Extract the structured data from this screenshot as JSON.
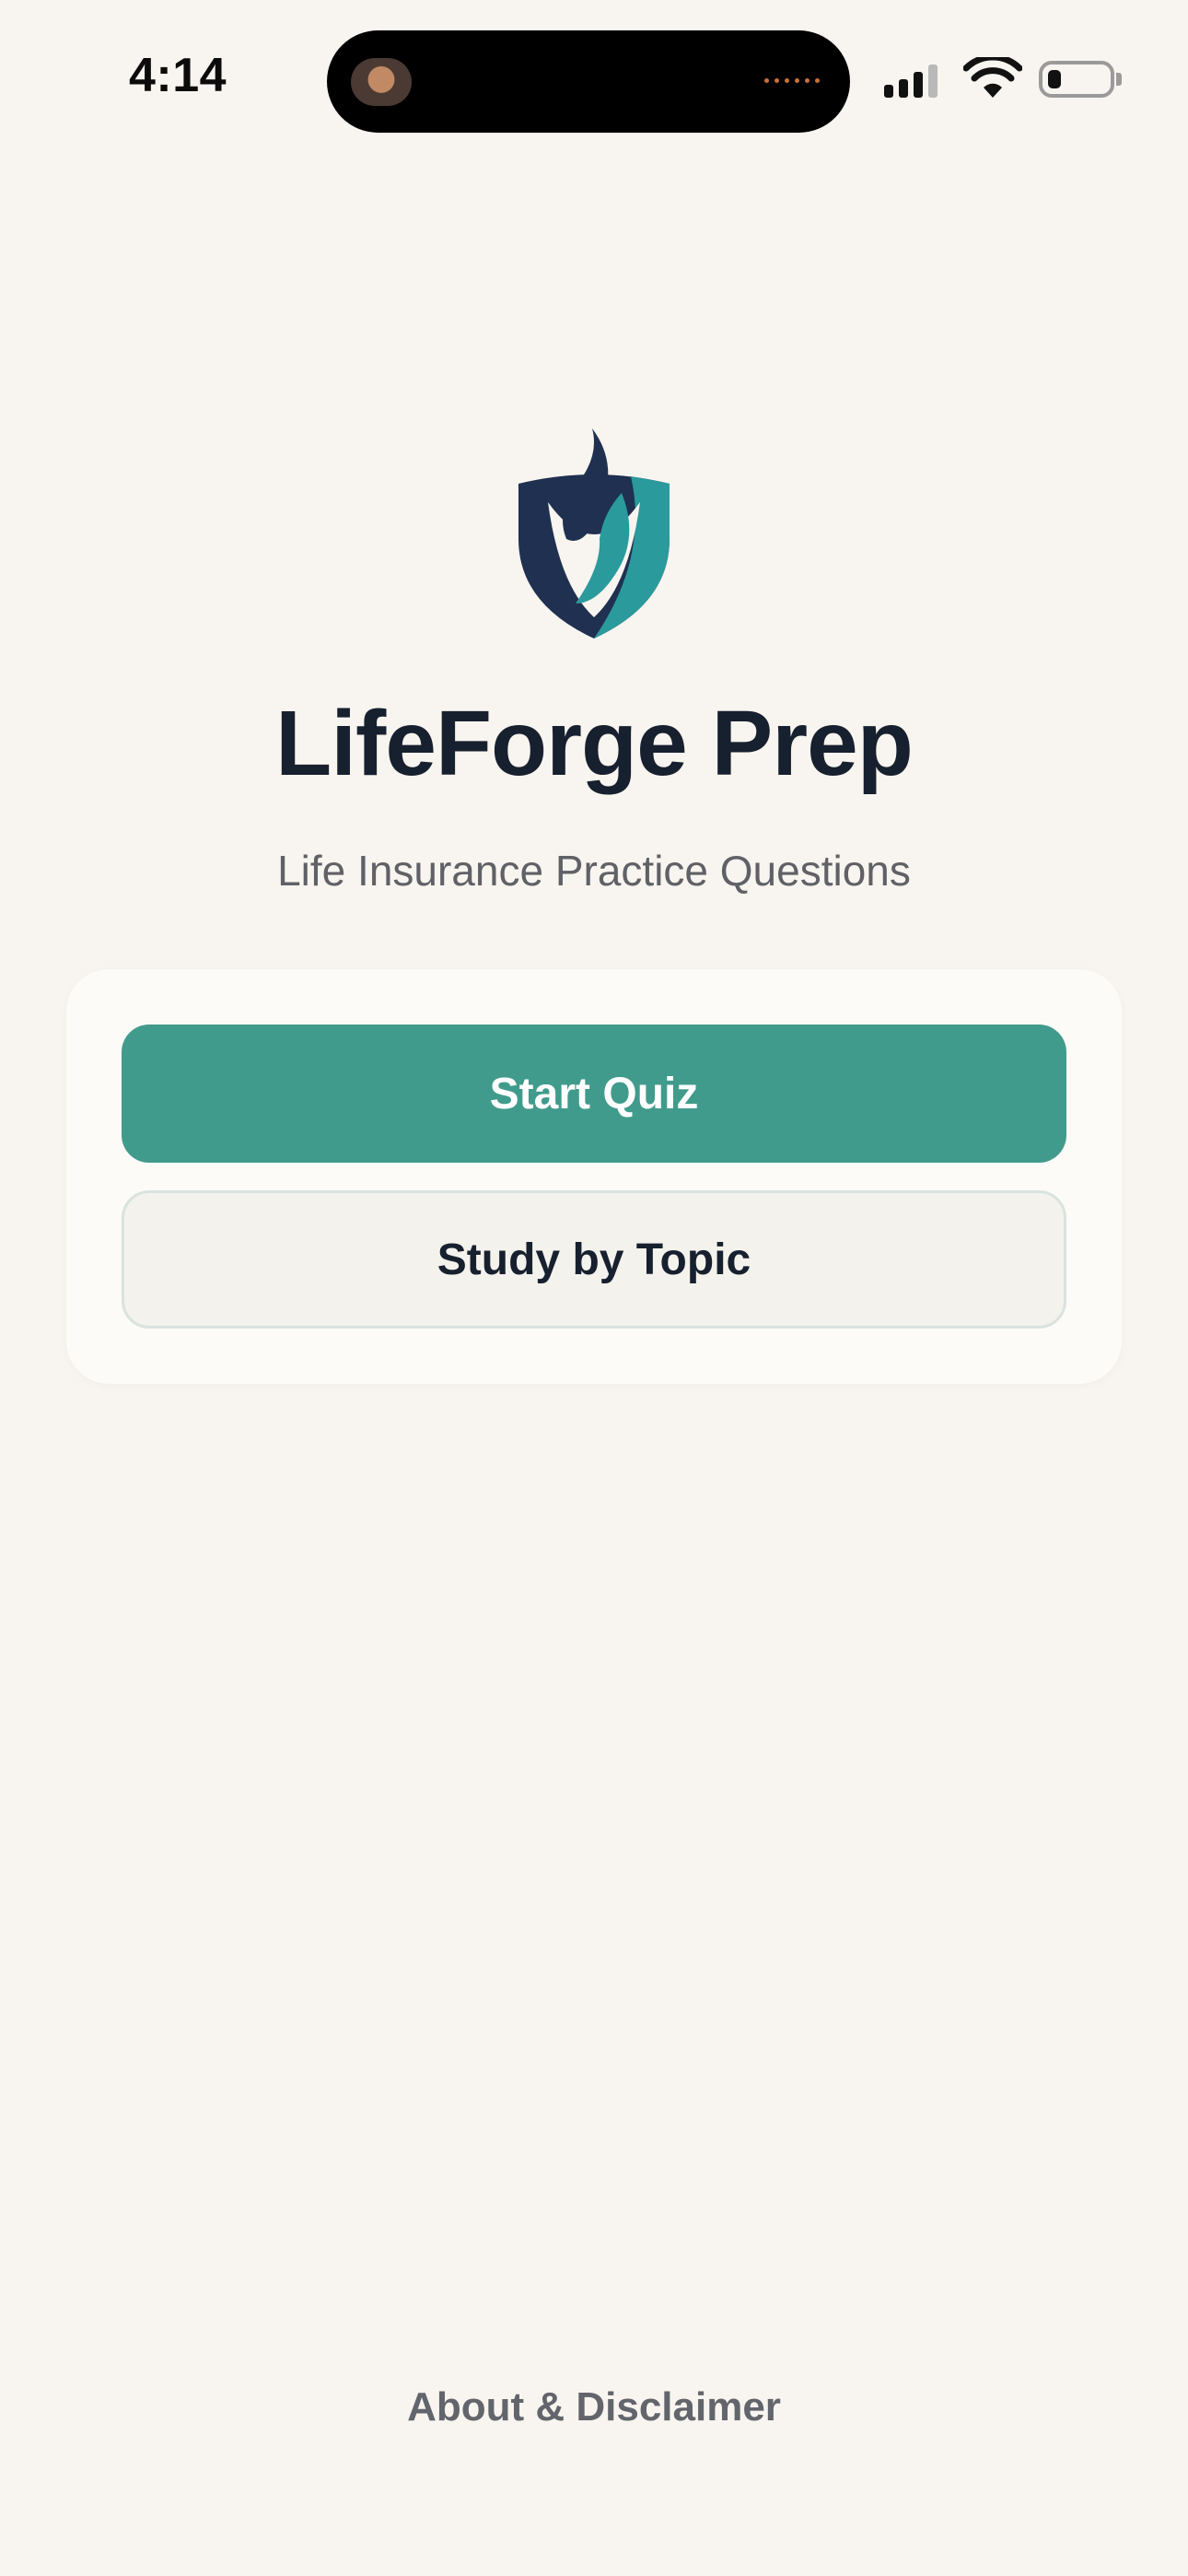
{
  "status_bar": {
    "time": "4:14"
  },
  "app": {
    "title": "LifeForge Prep",
    "subtitle": "Life Insurance Practice Questions",
    "logo_icon": "shield-flame-icon"
  },
  "actions": {
    "primary_label": "Start Quiz",
    "secondary_label": "Study by Topic"
  },
  "footer": {
    "link_label": "About & Disclaimer"
  },
  "colors": {
    "background": "#f8f4ef",
    "primary": "#419b8c",
    "navy": "#1f3050",
    "teal": "#2a9a9c",
    "title_text": "#17202e"
  }
}
